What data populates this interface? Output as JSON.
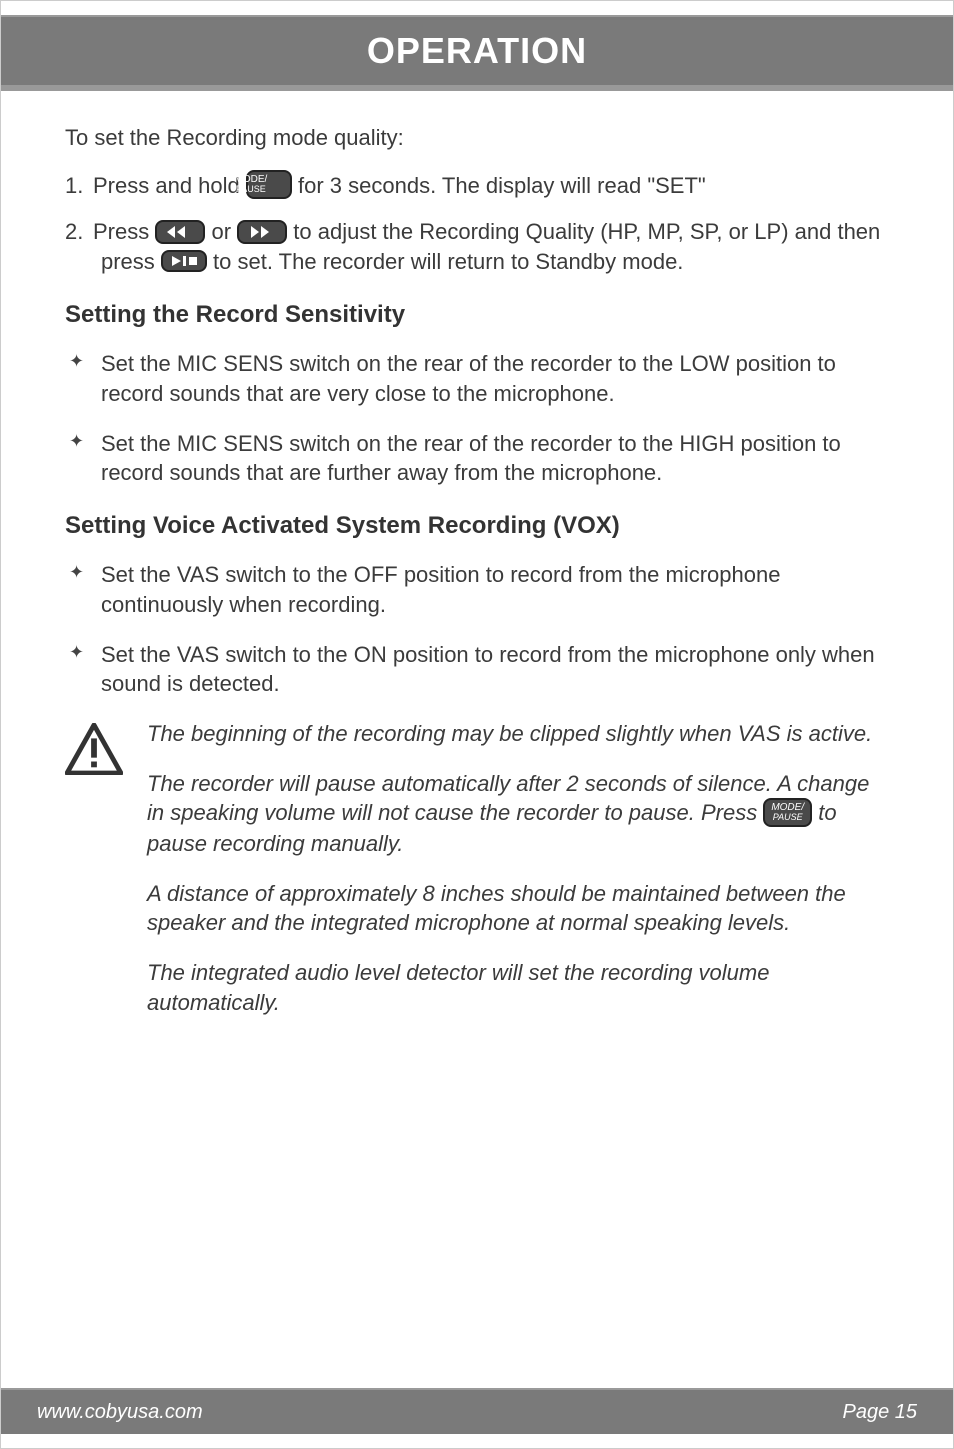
{
  "header": {
    "title": "OPERATION"
  },
  "intro": "To set the Recording mode quality:",
  "steps": [
    {
      "num": "1.",
      "pre": "Press and hold ",
      "btn1": "MODE/\nPAUSE",
      "post": " for 3 seconds. The display will read \"SET\""
    },
    {
      "num": "2.",
      "pre": "Press ",
      "mid1": " or ",
      "mid2": " to adjust the Recording Quality (HP, MP, SP, or LP) and then press ",
      "post": " to set. The recorder will return to Standby mode."
    }
  ],
  "section1": {
    "title": "Setting the Record Sensitivity",
    "items": [
      "Set the MIC SENS switch on the rear of the recorder to the LOW position to record sounds that are very close to the microphone.",
      "Set the MIC SENS switch on the rear of the recorder to the HIGH position to record sounds that are further away from the microphone."
    ]
  },
  "section2": {
    "title": "Setting Voice Activated System Recording (VOX)",
    "items": [
      "Set the VAS switch to the OFF position to record from the microphone continuously when recording.",
      "Set the VAS switch to the ON position to record from the microphone only when sound is detected."
    ]
  },
  "notes": {
    "p1": "The beginning of the recording may be clipped slightly when VAS is active.",
    "p2a": "The recorder will pause automatically after 2 seconds of silence. A change in speaking volume will not cause the recorder to pause. Press ",
    "p2b": " to pause recording manually.",
    "p3": "A distance of approximately 8 inches should be maintained between the speaker and the integrated microphone at normal speaking levels.",
    "p4": "The integrated audio level detector will set the recording volume automatically."
  },
  "icons": {
    "mode": "MODE/PAUSE",
    "rewind": "rewind-icon",
    "forward": "forward-icon",
    "playstop": "play-stop-icon",
    "warning": "warning-icon"
  },
  "footer": {
    "left": "www.cobyusa.com",
    "right": "Page 15"
  }
}
